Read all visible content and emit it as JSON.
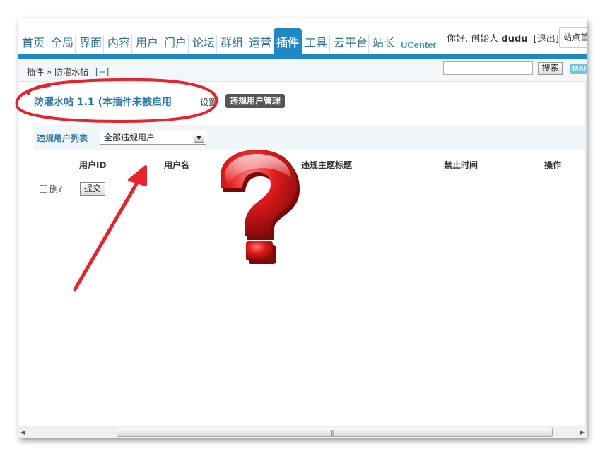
{
  "nav": {
    "items": [
      "首页",
      "全局",
      "界面",
      "内容",
      "用户",
      "门户",
      "论坛",
      "群组",
      "运营",
      "插件",
      "工具",
      "云平台",
      "站长",
      "UCenter"
    ],
    "active_index": 9
  },
  "user": {
    "greeting": "你好, 创始人",
    "name": "dudu",
    "logout": "[退出]",
    "site_button": "站点首页"
  },
  "subnav": {
    "crumb_root": "插件",
    "crumb_sep": "»",
    "crumb_current": "防灌水帖",
    "add_link": "[+]",
    "search_placeholder": "",
    "search_button": "搜索",
    "map_button": "MAP"
  },
  "plugin": {
    "title": "防灌水帖 1.1 (本插件未被启用",
    "tab_settings": "设置",
    "tab_violators": "违规用户管理"
  },
  "list": {
    "title": "违规用户列表",
    "filter_value": "全部违规用户",
    "columns": [
      "用户ID",
      "用户名",
      "违规主题标题",
      "禁止时间",
      "操作"
    ],
    "delete_label": "删?",
    "submit_button": "提交"
  },
  "colors": {
    "nav_active": "#1d89c9",
    "nav_text": "#2a6f9c",
    "annotation_red": "#e8232a"
  },
  "icons": [
    "question-mark-icon",
    "arrow-annotation"
  ]
}
